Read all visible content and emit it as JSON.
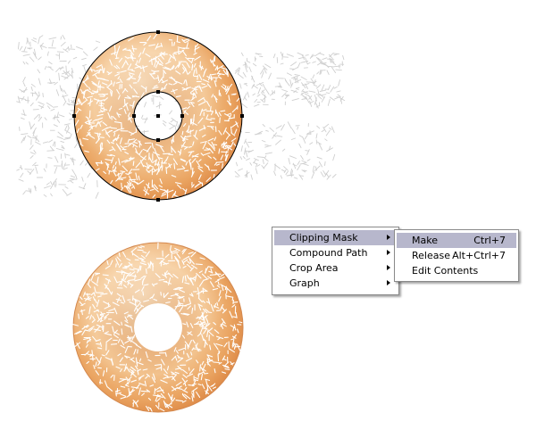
{
  "canvas": {
    "background": "#ffffff",
    "top_donut": {
      "state": "selected with clipping path",
      "handles": [
        "outer-top",
        "outer-bottom",
        "outer-left",
        "outer-right",
        "inner-top",
        "inner-bottom",
        "inner-left",
        "inner-right",
        "center"
      ]
    },
    "bottom_donut": {
      "state": "clipped result"
    },
    "colors": {
      "dough_light": "#f3c58d",
      "dough_mid": "#e9a25f",
      "dough_dark": "#d97a36",
      "sugar": "#ffffff",
      "stray_sugar": "#cfcfcf",
      "selection": "#000000"
    }
  },
  "context_menu": {
    "items": [
      {
        "label": "Clipping Mask",
        "has_submenu": true,
        "highlighted": true
      },
      {
        "label": "Compound Path",
        "has_submenu": true,
        "highlighted": false
      },
      {
        "label": "Crop Area",
        "has_submenu": true,
        "highlighted": false
      },
      {
        "label": "Graph",
        "has_submenu": true,
        "highlighted": false
      }
    ],
    "highlight_color": "#b7b7cc"
  },
  "submenu": {
    "items": [
      {
        "label": "Make",
        "shortcut": "Ctrl+7",
        "highlighted": true
      },
      {
        "label": "Release",
        "shortcut": "Alt+Ctrl+7",
        "highlighted": false
      },
      {
        "label": "Edit Contents",
        "shortcut": "",
        "highlighted": false
      }
    ]
  }
}
